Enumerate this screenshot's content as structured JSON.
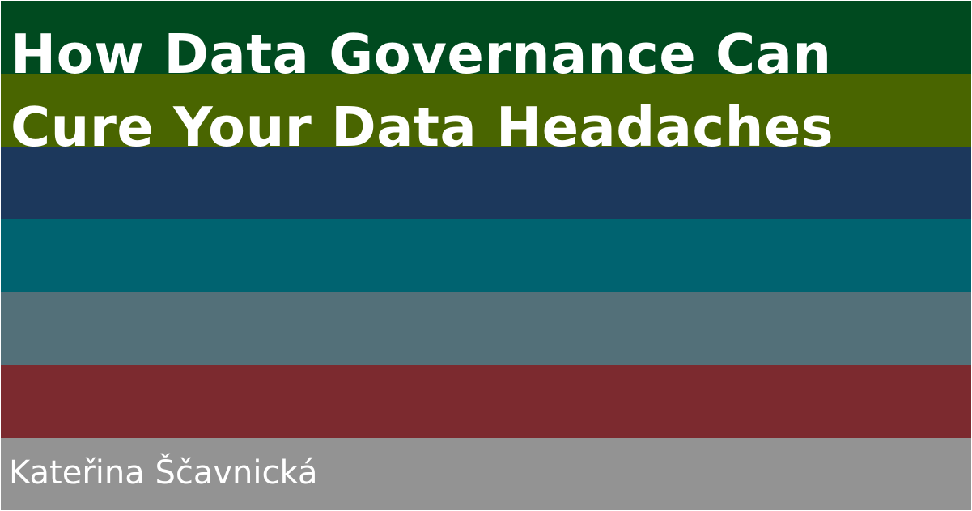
{
  "title_lines": [
    "How Data Governance Can",
    "Cure Your Data Headaches"
  ],
  "author": "Kateřina Ščavnická",
  "stripe_colors": [
    "#004a1f",
    "#496500",
    "#1c385c",
    "#006370",
    "#537079",
    "#7c2a2f",
    "#939393"
  ],
  "text_color": "#ffffff"
}
